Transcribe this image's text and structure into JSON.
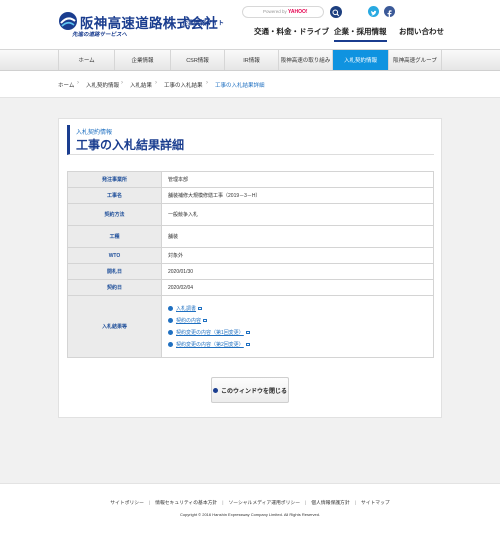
{
  "header": {
    "logo_name": "阪神高速道路株式会社",
    "logo_site": "企業情報サイト",
    "logo_tagline": "先進の道路サービスへ",
    "search_powered_label": "Powered by",
    "search_brand": "YAHOO!",
    "global_nav": [
      "交通・料金・ドライブ",
      "企業・採用情報",
      "お問い合わせ"
    ],
    "global_nav_active": "企業・採用情報"
  },
  "navbar": {
    "items": [
      "ホーム",
      "企業情報",
      "CSR情報",
      "IR情報",
      "阪神高速の取り組み",
      "入札契約情報",
      "阪神高速グループ"
    ],
    "active": "入札契約情報"
  },
  "breadcrumb": [
    "ホーム",
    "入札契約情報",
    "入札結果",
    "工事の入札結果",
    "工事の入札結果詳細"
  ],
  "page": {
    "subtitle": "入札契約情報",
    "title": "工事の入札結果詳細"
  },
  "table": {
    "rows": [
      {
        "label": "発注事業所",
        "value": "管理本部"
      },
      {
        "label": "工事名",
        "value": "舗装補修大規模修繕工事（2019－3－H）"
      },
      {
        "label": "契約方法",
        "value": "一般競争入札"
      },
      {
        "label": "工種",
        "value": "舗装"
      },
      {
        "label": "WTO",
        "value": "対象外"
      },
      {
        "label": "開札日",
        "value": "2020/01/30"
      },
      {
        "label": "契約日",
        "value": "2020/02/04"
      }
    ],
    "result_label": "入札結果等",
    "result_links": [
      "入札調書",
      "契約の内容",
      "契約変更の内容（第1回変更）",
      "契約変更の内容（第2回変更）"
    ]
  },
  "close_button": "このウィンドウを閉じる",
  "footer": {
    "links": [
      "サイトポリシー",
      "情報セキュリティの基本方針",
      "ソーシャルメディア運用ポリシー",
      "個人情報保護方針",
      "サイトマップ"
    ],
    "copyright": "Copyright © 2016 Hanshin Expressway Company Limited. All Rights Reserved."
  },
  "colors": {
    "brand": "#1a3d8f",
    "accent": "#0f93e0",
    "link": "#1f70c1"
  },
  "icons": [
    "search-icon",
    "twitter-icon",
    "facebook-icon",
    "external-link-icon",
    "bullet-arrow-icon"
  ]
}
